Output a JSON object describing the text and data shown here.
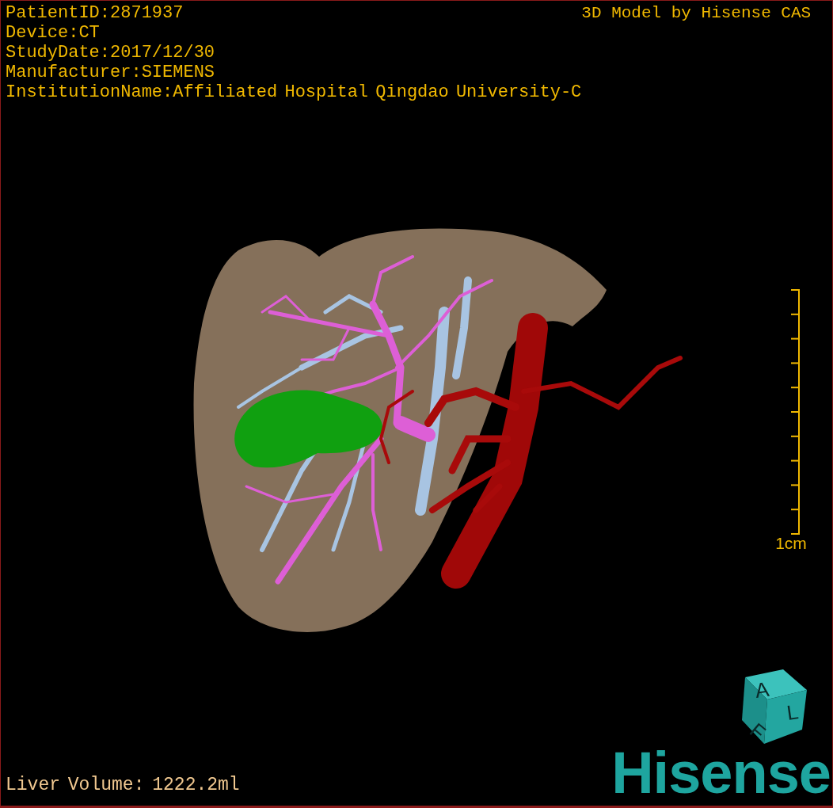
{
  "info_lines": [
    "PatientID:2871937",
    "Device:CT",
    "StudyDate:2017/12/30",
    "Manufacturer:SIEMENS",
    "InstitutionName:Affiliated Hospital Qingdao University-C"
  ],
  "title": "3D Model by Hisense CAS",
  "scale_bar": {
    "label": "1cm"
  },
  "measurement": "Liver Volume: 1222.2ml",
  "logo": {
    "cube_labels": [
      "A",
      "L",
      "F"
    ],
    "wordmark": "Hisense"
  }
}
